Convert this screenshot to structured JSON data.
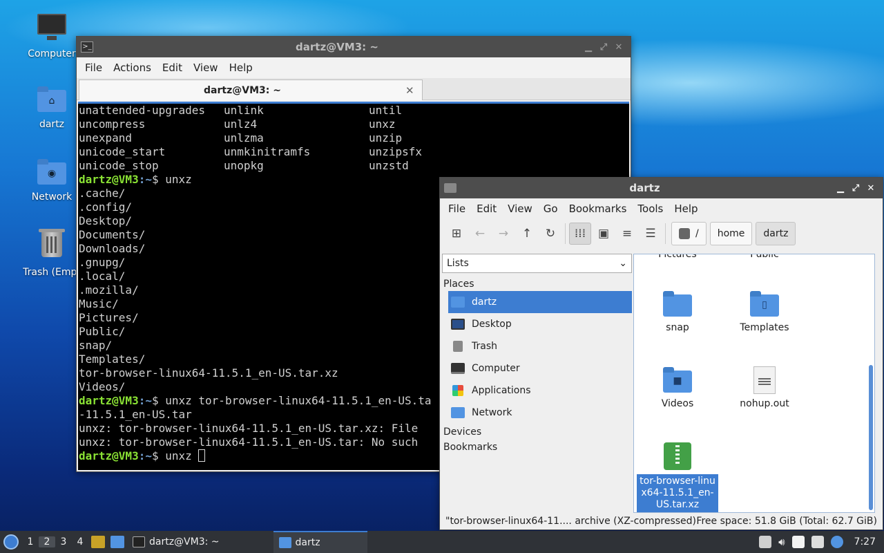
{
  "desktop": {
    "icons": [
      {
        "label": "Computer",
        "icon": "computer-icon"
      },
      {
        "label": "dartz",
        "icon": "home-folder-icon"
      },
      {
        "label": "Network",
        "icon": "network-folder-icon"
      },
      {
        "label": "Trash (Empt",
        "icon": "trash-icon"
      }
    ]
  },
  "terminal": {
    "title": "dartz@VM3: ~",
    "menu": [
      "File",
      "Actions",
      "Edit",
      "View",
      "Help"
    ],
    "tab_title": "dartz@VM3: ~",
    "tab_close": "✕",
    "prompt_user": "dartz@VM3",
    "prompt_path": ":~",
    "prompt_symbol": "$",
    "completion_rows": [
      [
        "unattended-upgrades",
        "unlink",
        "until"
      ],
      [
        "uncompress",
        "unlz4",
        "unxz"
      ],
      [
        "unexpand",
        "unlzma",
        "unzip"
      ],
      [
        "unicode_start",
        "unmkinitramfs",
        "unzipsfx"
      ],
      [
        "unicode_stop",
        "unopkg",
        "unzstd"
      ]
    ],
    "cmd1": " unxz",
    "listing": [
      ".cache/",
      ".config/",
      "Desktop/",
      "Documents/",
      "Downloads/",
      ".gnupg/",
      ".local/",
      ".mozilla/",
      "Music/",
      "Pictures/",
      "Public/",
      "snap/",
      "Templates/",
      "tor-browser-linux64-11.5.1_en-US.tar.xz",
      "Videos/"
    ],
    "cmd2": " unxz tor-browser-linux64-11.5.1_en-US.ta",
    "cmd2_wrap": "-11.5.1_en-US.tar",
    "err1": "unxz: tor-browser-linux64-11.5.1_en-US.tar.xz: File",
    "err2": "unxz: tor-browser-linux64-11.5.1_en-US.tar: No such",
    "cmd3": " unxz "
  },
  "filemanager": {
    "title": "dartz",
    "menu": [
      "File",
      "Edit",
      "View",
      "Go",
      "Bookmarks",
      "Tools",
      "Help"
    ],
    "breadcrumbs": {
      "root": "/",
      "home": "home",
      "current": "dartz"
    },
    "side_mode": "Lists",
    "places_heading": "Places",
    "places": [
      {
        "label": "dartz",
        "icon": "home-icon"
      },
      {
        "label": "Desktop",
        "icon": "desktop-icon"
      },
      {
        "label": "Trash",
        "icon": "trash-icon"
      },
      {
        "label": "Computer",
        "icon": "computer-icon"
      },
      {
        "label": "Applications",
        "icon": "applications-icon"
      },
      {
        "label": "Network",
        "icon": "network-icon"
      }
    ],
    "devices_heading": "Devices",
    "bookmarks_heading": "Bookmarks",
    "files_partial": [
      "Pictures",
      "Public"
    ],
    "files": [
      {
        "label": "snap",
        "kind": "folder"
      },
      {
        "label": "Templates",
        "kind": "folder-templates"
      },
      {
        "label": "Videos",
        "kind": "folder-videos"
      },
      {
        "label": "nohup.out",
        "kind": "text"
      },
      {
        "label": "tor-browser-linux64-11.5.1_en-US.tar.xz",
        "kind": "archive"
      }
    ],
    "status_left": "\"tor-browser-linux64-11.... archive (XZ-compressed)",
    "status_right": "Free space: 51.8 GiB (Total: 62.7 GiB)"
  },
  "taskbar": {
    "workspaces": [
      "1",
      "2",
      "3",
      "4"
    ],
    "current_workspace": "2",
    "tasks": [
      {
        "label": "dartz@VM3: ~",
        "icon": "terminal-icon"
      },
      {
        "label": "dartz",
        "icon": "folder-icon"
      }
    ],
    "clock": "7:27"
  },
  "colors": {
    "accent": "#3d7dd1",
    "prompt_user": "#8ae234",
    "prompt_path": "#729fcf",
    "titlebar": "#4d4d4d",
    "taskbar": "#2f3237"
  }
}
